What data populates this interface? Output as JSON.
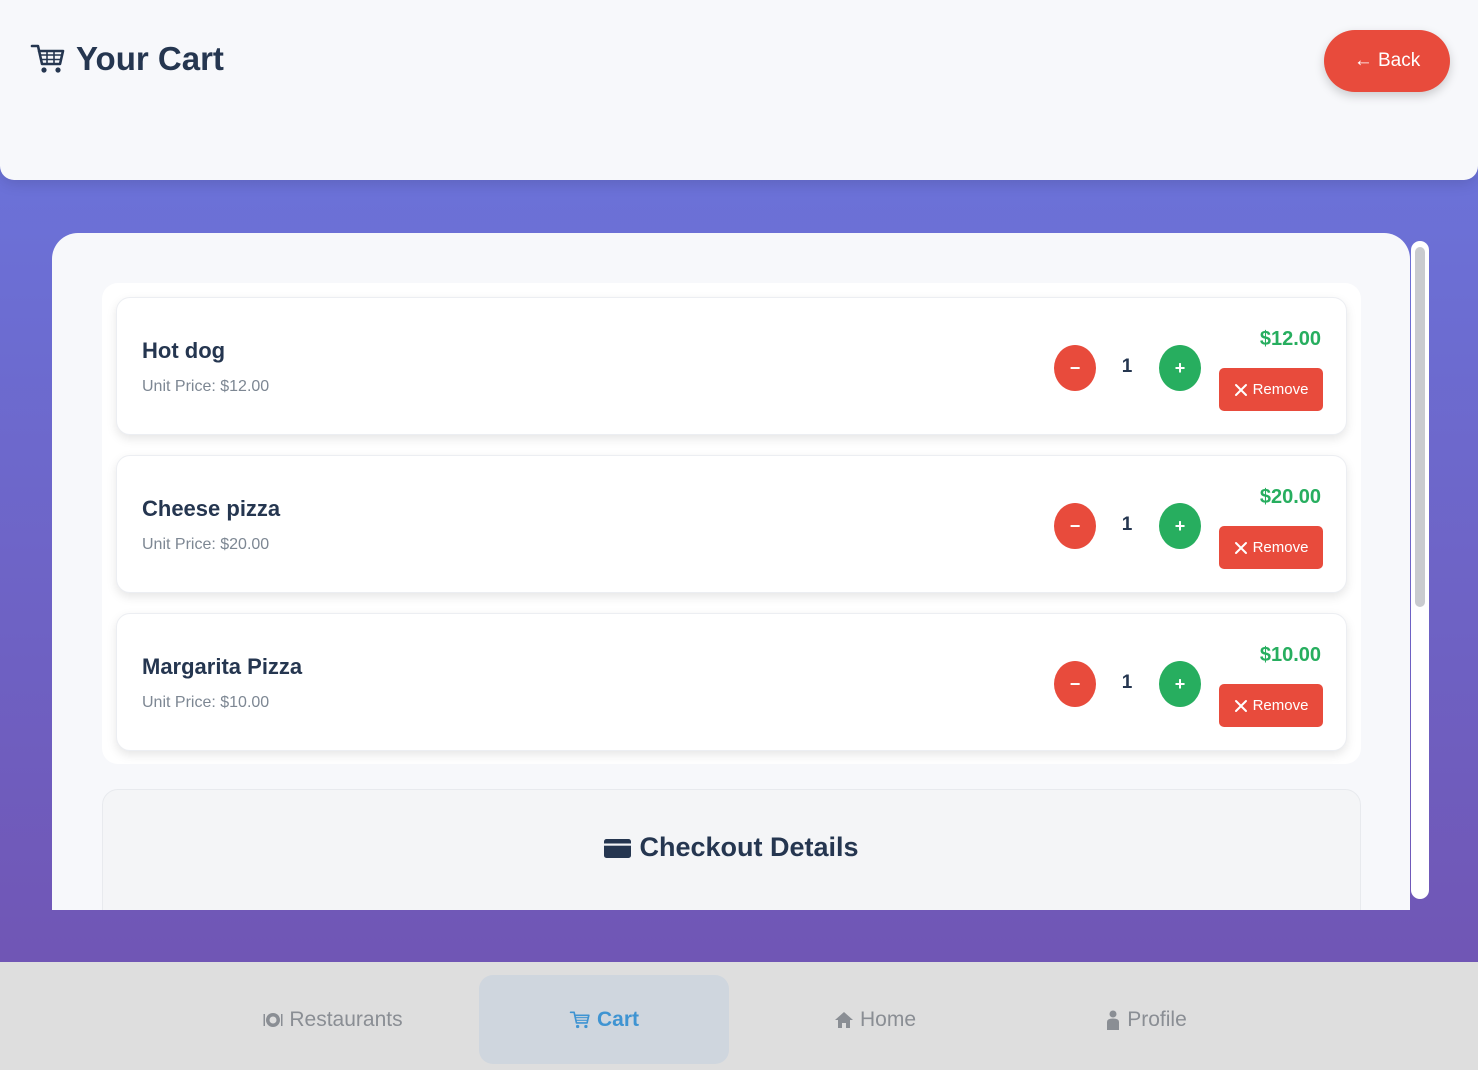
{
  "header": {
    "title": "Your Cart",
    "back_label": "← Back"
  },
  "cart": {
    "items": [
      {
        "name": "Hot dog",
        "unit_price": "Unit Price: $12.00",
        "quantity": "1",
        "total": "$12.00",
        "minus": "−",
        "plus": "+",
        "remove_label": "Remove"
      },
      {
        "name": "Cheese pizza",
        "unit_price": "Unit Price: $20.00",
        "quantity": "1",
        "total": "$20.00",
        "minus": "−",
        "plus": "+",
        "remove_label": "Remove"
      },
      {
        "name": "Margarita Pizza",
        "unit_price": "Unit Price: $10.00",
        "quantity": "1",
        "total": "$10.00",
        "minus": "−",
        "plus": "+",
        "remove_label": "Remove"
      }
    ]
  },
  "checkout": {
    "title": "Checkout Details"
  },
  "nav": {
    "items": [
      {
        "label": "Restaurants",
        "icon": "plate-icon",
        "active": false
      },
      {
        "label": "Cart",
        "icon": "cart-icon",
        "active": true
      },
      {
        "label": "Home",
        "icon": "home-icon",
        "active": false
      },
      {
        "label": "Profile",
        "icon": "person-icon",
        "active": false
      }
    ]
  },
  "colors": {
    "accent_red": "#e84b3c",
    "accent_green": "#27ae5f",
    "nav_active": "#3f94d2",
    "text_dark": "#253650"
  }
}
